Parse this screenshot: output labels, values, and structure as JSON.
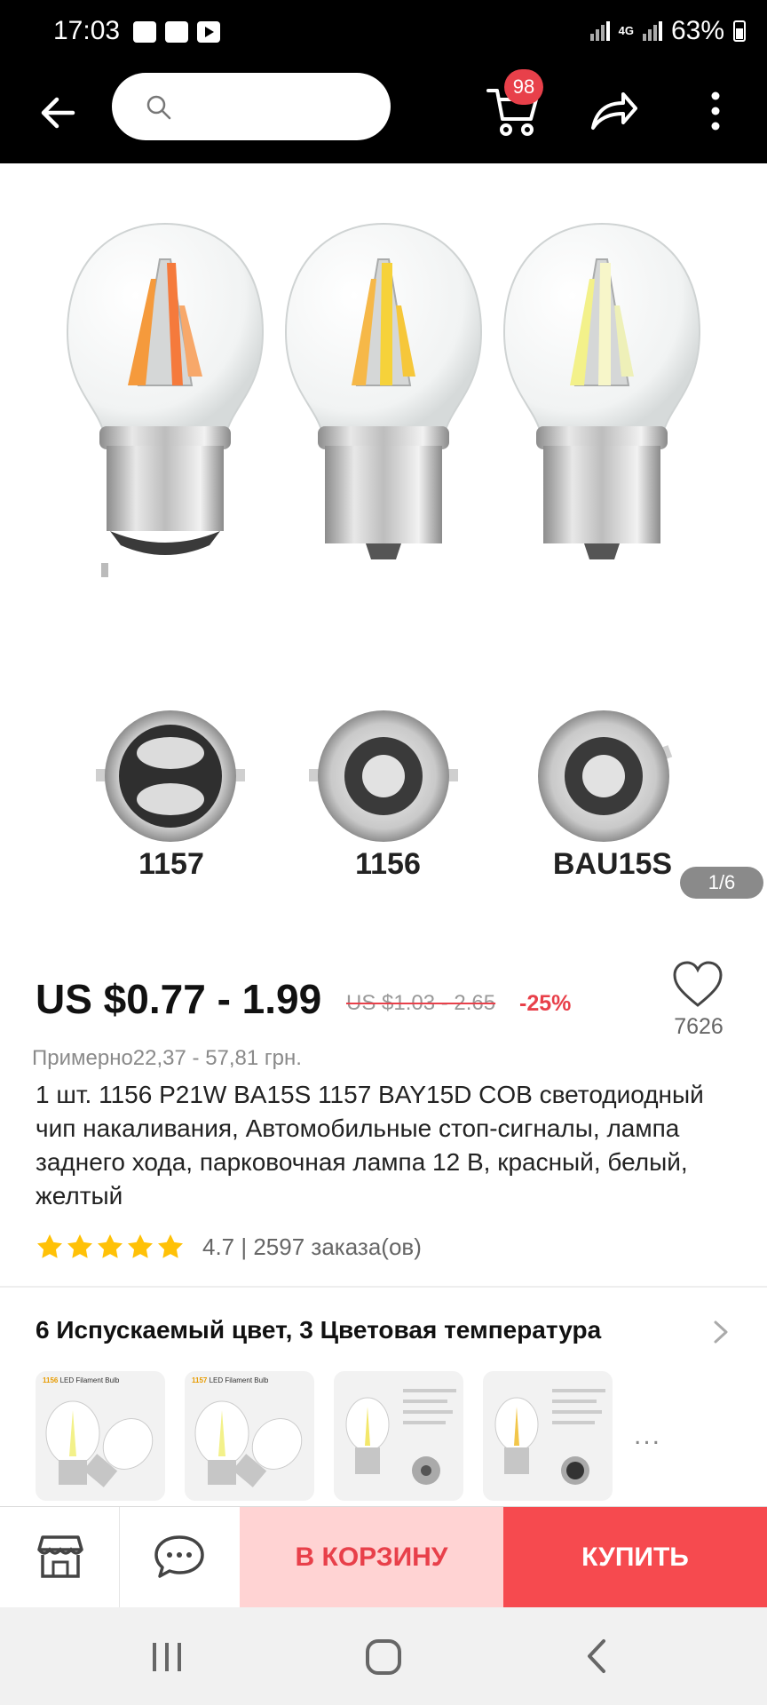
{
  "status_bar": {
    "time": "17:03",
    "network": "4G",
    "battery": "63%",
    "notification_icons": [
      "gallery-icon",
      "music-icon",
      "youtube-icon"
    ]
  },
  "toolbar": {
    "search_placeholder": "",
    "cart_badge": "98",
    "icons": [
      "back-arrow-icon",
      "search-icon",
      "cart-icon",
      "share-icon",
      "more-icon"
    ]
  },
  "gallery": {
    "captions": [
      "1157",
      "1156",
      "BAU15S"
    ],
    "pager": "1/6",
    "colors": {
      "orange_chip": "#f59a3c",
      "amber_chip": "#f6c73a",
      "white_chip": "#f3f18a"
    }
  },
  "product": {
    "price": "US $0.77 - 1.99",
    "old_price": "US $1.03 - 2.65",
    "discount": "-25%",
    "wishlist_count": "7626",
    "approx_price": "Примерно22,37 - 57,81 грн.",
    "title": "1 шт. 1156 P21W BA15S 1157 BAY15D COB светодиодный чип накаливания, Автомобильные стоп-сигналы, лампа заднего хода, парковочная лампа 12 В, красный, белый, желтый",
    "rating_value": 4.7,
    "rating_text": "4.7 | 2597 заказа(ов)"
  },
  "variants": {
    "title": "6 Испускаемый цвет, 3 Цветовая температура",
    "thumbs": [
      {
        "tag_num": "1156",
        "tag_text": "LED Filament Bulb"
      },
      {
        "tag_num": "1157",
        "tag_text": "LED Filament Bulb"
      },
      {
        "tag_num": "",
        "tag_text": ""
      },
      {
        "tag_num": "",
        "tag_text": ""
      }
    ],
    "more": "..."
  },
  "actions": {
    "add_to_cart": "В КОРЗИНУ",
    "buy": "КУПИТЬ",
    "accent": "#f64a4f",
    "accent_light": "#ffd3d3"
  },
  "navigation": {
    "icons": [
      "recent-apps-icon",
      "home-icon",
      "back-icon"
    ]
  }
}
